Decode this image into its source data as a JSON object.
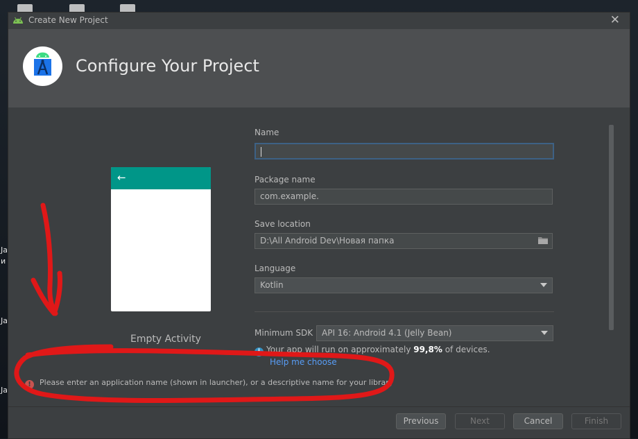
{
  "window": {
    "title": "Create New Project",
    "close_glyph": "✕"
  },
  "header": {
    "title": "Configure Your Project",
    "logo_icon": "android-studio-icon"
  },
  "preview": {
    "activity_name": "Empty Activity",
    "back_glyph": "←"
  },
  "form": {
    "name": {
      "label": "Name",
      "value": ""
    },
    "package": {
      "label": "Package name",
      "value": "com.example."
    },
    "save_location": {
      "label": "Save location",
      "value": "D:\\All Android Dev\\Новая папка"
    },
    "language": {
      "label": "Language",
      "value": "Kotlin"
    },
    "min_sdk": {
      "label": "Minimum SDK",
      "value": "API 16: Android 4.1 (Jelly Bean)"
    },
    "info": {
      "prefix": "Your app will run on approximately ",
      "percent": "99,8%",
      "suffix": " of devices."
    },
    "help_link": "Help me choose"
  },
  "error": {
    "message": "Please enter an application name (shown in launcher), or a descriptive name for your library"
  },
  "footer": {
    "previous": "Previous",
    "next": "Next",
    "cancel": "Cancel",
    "finish": "Finish"
  },
  "desktop": {
    "labels": [
      "Ja",
      "и",
      "Ja",
      "Ja"
    ]
  },
  "colors": {
    "accent_teal": "#009688",
    "error_red": "#c75450",
    "link_blue": "#589df6",
    "annotation_red": "#e01818"
  }
}
